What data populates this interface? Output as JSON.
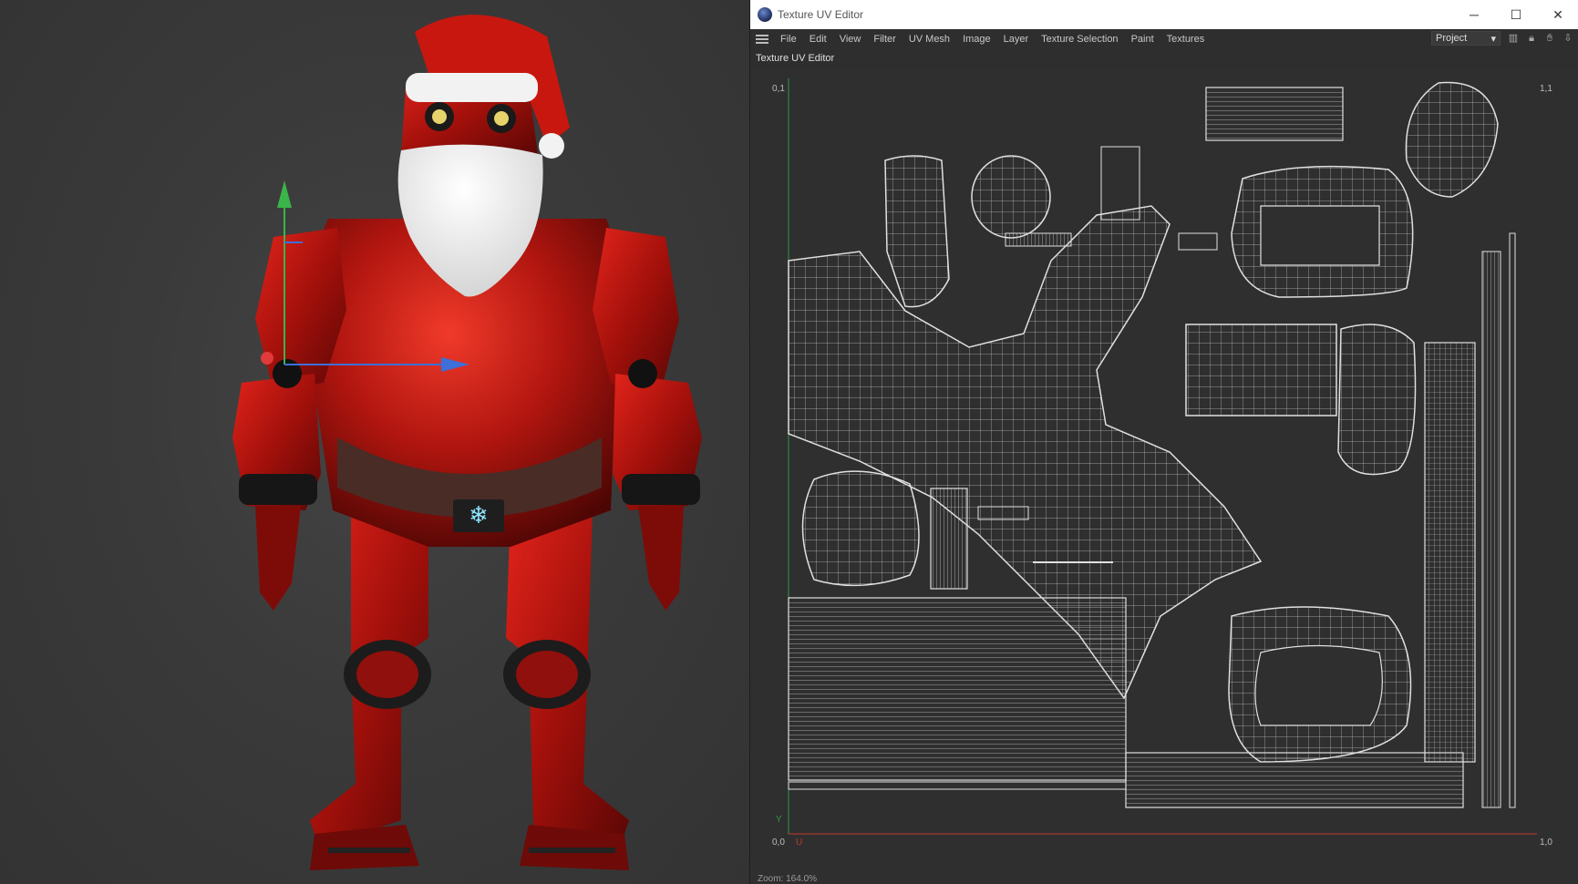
{
  "window": {
    "title": "Texture UV Editor",
    "controls": {
      "minimize": "─",
      "maximize": "☐",
      "close": "✕"
    }
  },
  "menu": {
    "items": [
      "File",
      "Edit",
      "View",
      "Filter",
      "UV Mesh",
      "Image",
      "Layer",
      "Texture Selection",
      "Paint",
      "Textures"
    ],
    "project_select": "Project"
  },
  "panel": {
    "title": "Texture UV Editor"
  },
  "uv_grid": {
    "corner_top_left": "0,1",
    "corner_top_right": "1,1",
    "corner_bottom_left": "0,0",
    "corner_bottom_right": "1,0",
    "axis_v": "Y",
    "axis_u": "U",
    "zoom": "Zoom: 164.0%"
  },
  "colors": {
    "uv_line": "#d8d8d8",
    "u_axis": "#c0392b",
    "v_axis": "#2e9a4a",
    "santa_red": "#b3140f",
    "gizmo_green": "#3ab54a",
    "gizmo_blue": "#3d6fd8"
  },
  "icons": [
    "app-icon",
    "hamburger-icon",
    "chart-icon",
    "lock-icon",
    "hand-icon",
    "pin-icon"
  ]
}
